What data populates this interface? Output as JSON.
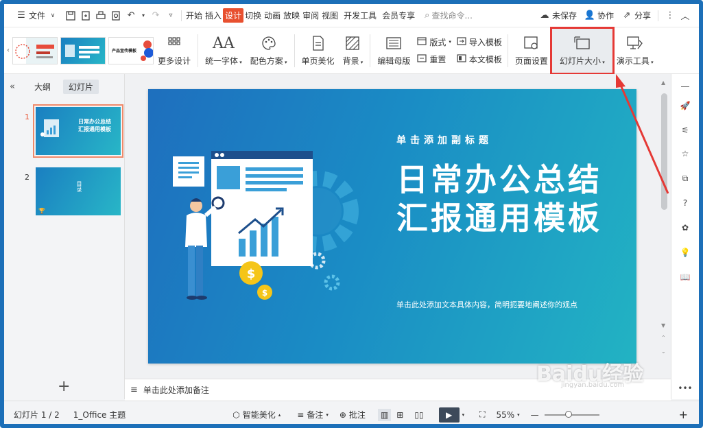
{
  "menubar": {
    "file_label": "文件",
    "tabs": [
      "开始",
      "插入",
      "设计",
      "切换",
      "动画",
      "放映",
      "审阅",
      "视图",
      "开发工具",
      "会员专享"
    ],
    "active_tab": "设计",
    "search_placeholder": "查找命令...",
    "unsaved": "未保存",
    "collab": "协作",
    "share": "分享"
  },
  "ribbon": {
    "more_design": "更多设计",
    "unify_font": "统一字体",
    "color_scheme": "配色方案",
    "single_beautify": "单页美化",
    "background": "背景",
    "edit_master": "编辑母版",
    "layout": "版式",
    "reset": "重置",
    "import_template": "导入模板",
    "this_template": "本文模板",
    "page_setup": "页面设置",
    "slide_size": "幻灯片大小",
    "presentation_tools": "演示工具",
    "thumb3_text": "产品宣传模板"
  },
  "leftpane": {
    "tab_outline": "大纲",
    "tab_slides": "幻灯片",
    "slides": [
      {
        "num": "1",
        "text": "日常办公总结汇报通用模板"
      },
      {
        "num": "2",
        "text": "目录"
      }
    ]
  },
  "slide": {
    "subtitle": "单击添加副标题",
    "title": "日常办公总结汇报通用模板",
    "description": "单击此处添加文本具体内容，简明扼要地阐述你的观点"
  },
  "notes": {
    "placeholder": "单击此处添加备注"
  },
  "statusbar": {
    "slide_count": "幻灯片 1 / 2",
    "theme": "1_Office 主题",
    "smart_beautify": "智能美化",
    "notes": "备注",
    "comment": "批注",
    "zoom": "55%"
  },
  "watermark": {
    "main": "Baidu经验",
    "sub": "jingyan.baidu.com"
  },
  "colors": {
    "accent": "#e8502f",
    "highlight_box": "#e53935",
    "slide_start": "#1e6fbe",
    "slide_end": "#22b3c3"
  }
}
